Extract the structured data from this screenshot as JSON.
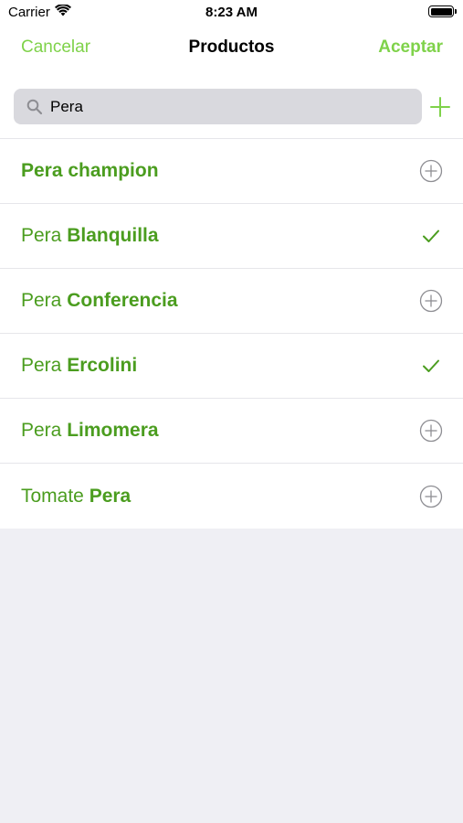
{
  "status": {
    "carrier": "Carrier",
    "time": "8:23 AM"
  },
  "nav": {
    "cancel": "Cancelar",
    "title": "Productos",
    "accept": "Aceptar"
  },
  "search": {
    "value": "Pera"
  },
  "products": [
    {
      "light": "",
      "bold": "Pera champion",
      "state": "add"
    },
    {
      "light": "Pera ",
      "bold": "Blanquilla",
      "state": "checked"
    },
    {
      "light": "Pera ",
      "bold": "Conferencia",
      "state": "add"
    },
    {
      "light": "Pera ",
      "bold": "Ercolini",
      "state": "checked"
    },
    {
      "light": "Pera ",
      "bold": "Limomera",
      "state": "add"
    },
    {
      "light": "Tomate ",
      "bold": "Pera",
      "state": "add"
    }
  ],
  "colors": {
    "accent": "#7fd24a",
    "item_text": "#4b9d1f",
    "background": "#efeff4"
  },
  "icons": {
    "search": "search-icon",
    "add": "plus-icon",
    "row_add": "circle-plus-icon",
    "row_checked": "checkmark-icon"
  }
}
